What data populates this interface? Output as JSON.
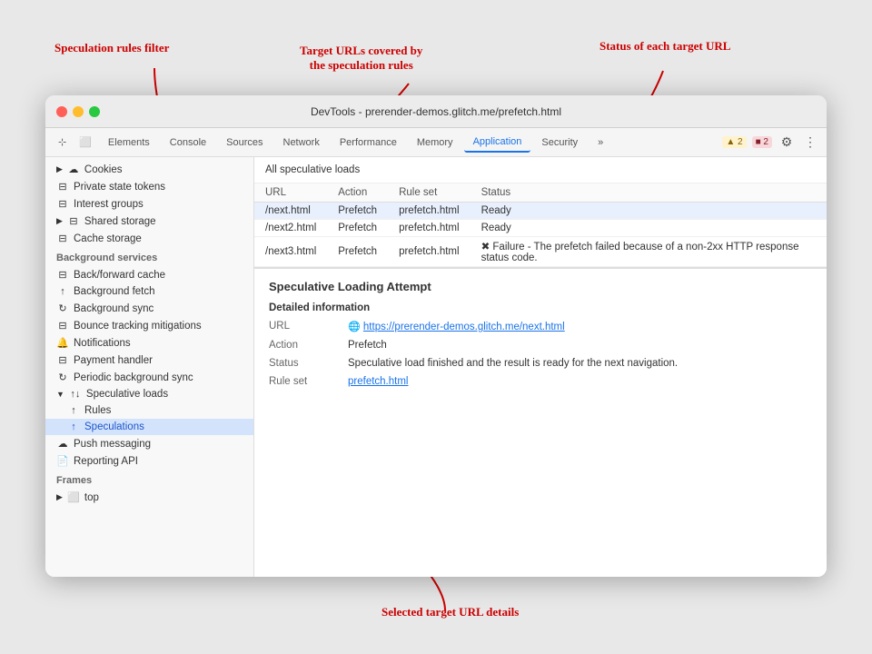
{
  "annotations": {
    "speculation_filter": "Speculation rules filter",
    "target_urls": "Target URLs covered by\nthe speculation rules",
    "status_each": "Status of each target URL",
    "selected_details": "Selected target URL details"
  },
  "titlebar": {
    "title": "DevTools - prerender-demos.glitch.me/prefetch.html"
  },
  "toolbar": {
    "tabs": [
      {
        "label": "Elements",
        "active": false
      },
      {
        "label": "Console",
        "active": false
      },
      {
        "label": "Sources",
        "active": false
      },
      {
        "label": "Network",
        "active": false
      },
      {
        "label": "Performance",
        "active": false
      },
      {
        "label": "Memory",
        "active": false
      },
      {
        "label": "Application",
        "active": true
      },
      {
        "label": "Security",
        "active": false
      },
      {
        "label": "»",
        "active": false
      }
    ],
    "badge_warn": "▲ 2",
    "badge_err": "■ 2"
  },
  "sidebar": {
    "cookies_label": "Cookies",
    "private_state_tokens": "Private state tokens",
    "interest_groups": "Interest groups",
    "shared_storage": "Shared storage",
    "cache_storage": "Cache storage",
    "bg_services_label": "Background services",
    "back_forward": "Back/forward cache",
    "bg_fetch": "Background fetch",
    "bg_sync": "Background sync",
    "bounce_tracking": "Bounce tracking mitigations",
    "notifications": "Notifications",
    "payment_handler": "Payment handler",
    "periodic_bg_sync": "Periodic background sync",
    "speculative_loads": "Speculative loads",
    "rules": "Rules",
    "speculations": "Speculations",
    "push_messaging": "Push messaging",
    "reporting_api": "Reporting API",
    "frames_label": "Frames",
    "frames_top": "top"
  },
  "speculative_loads": {
    "all_label": "All speculative loads",
    "columns": [
      "URL",
      "Action",
      "Rule set",
      "Status"
    ],
    "rows": [
      {
        "url": "/next.html",
        "action": "Prefetch",
        "ruleset": "prefetch.html",
        "status": "Ready",
        "error": false
      },
      {
        "url": "/next2.html",
        "action": "Prefetch",
        "ruleset": "prefetch.html",
        "status": "Ready",
        "error": false
      },
      {
        "url": "/next3.html",
        "action": "Prefetch",
        "ruleset": "prefetch.html",
        "status": "✖ Failure - The prefetch failed because of a non-2xx HTTP response status code.",
        "error": true
      }
    ]
  },
  "detail": {
    "title": "Speculative Loading Attempt",
    "subtitle": "Detailed information",
    "url_label": "URL",
    "url_value": "https://prerender-demos.glitch.me/next.html",
    "action_label": "Action",
    "action_value": "Prefetch",
    "status_label": "Status",
    "status_value": "Speculative load finished and the result is ready for the next navigation.",
    "ruleset_label": "Rule set",
    "ruleset_value": "prefetch.html"
  }
}
